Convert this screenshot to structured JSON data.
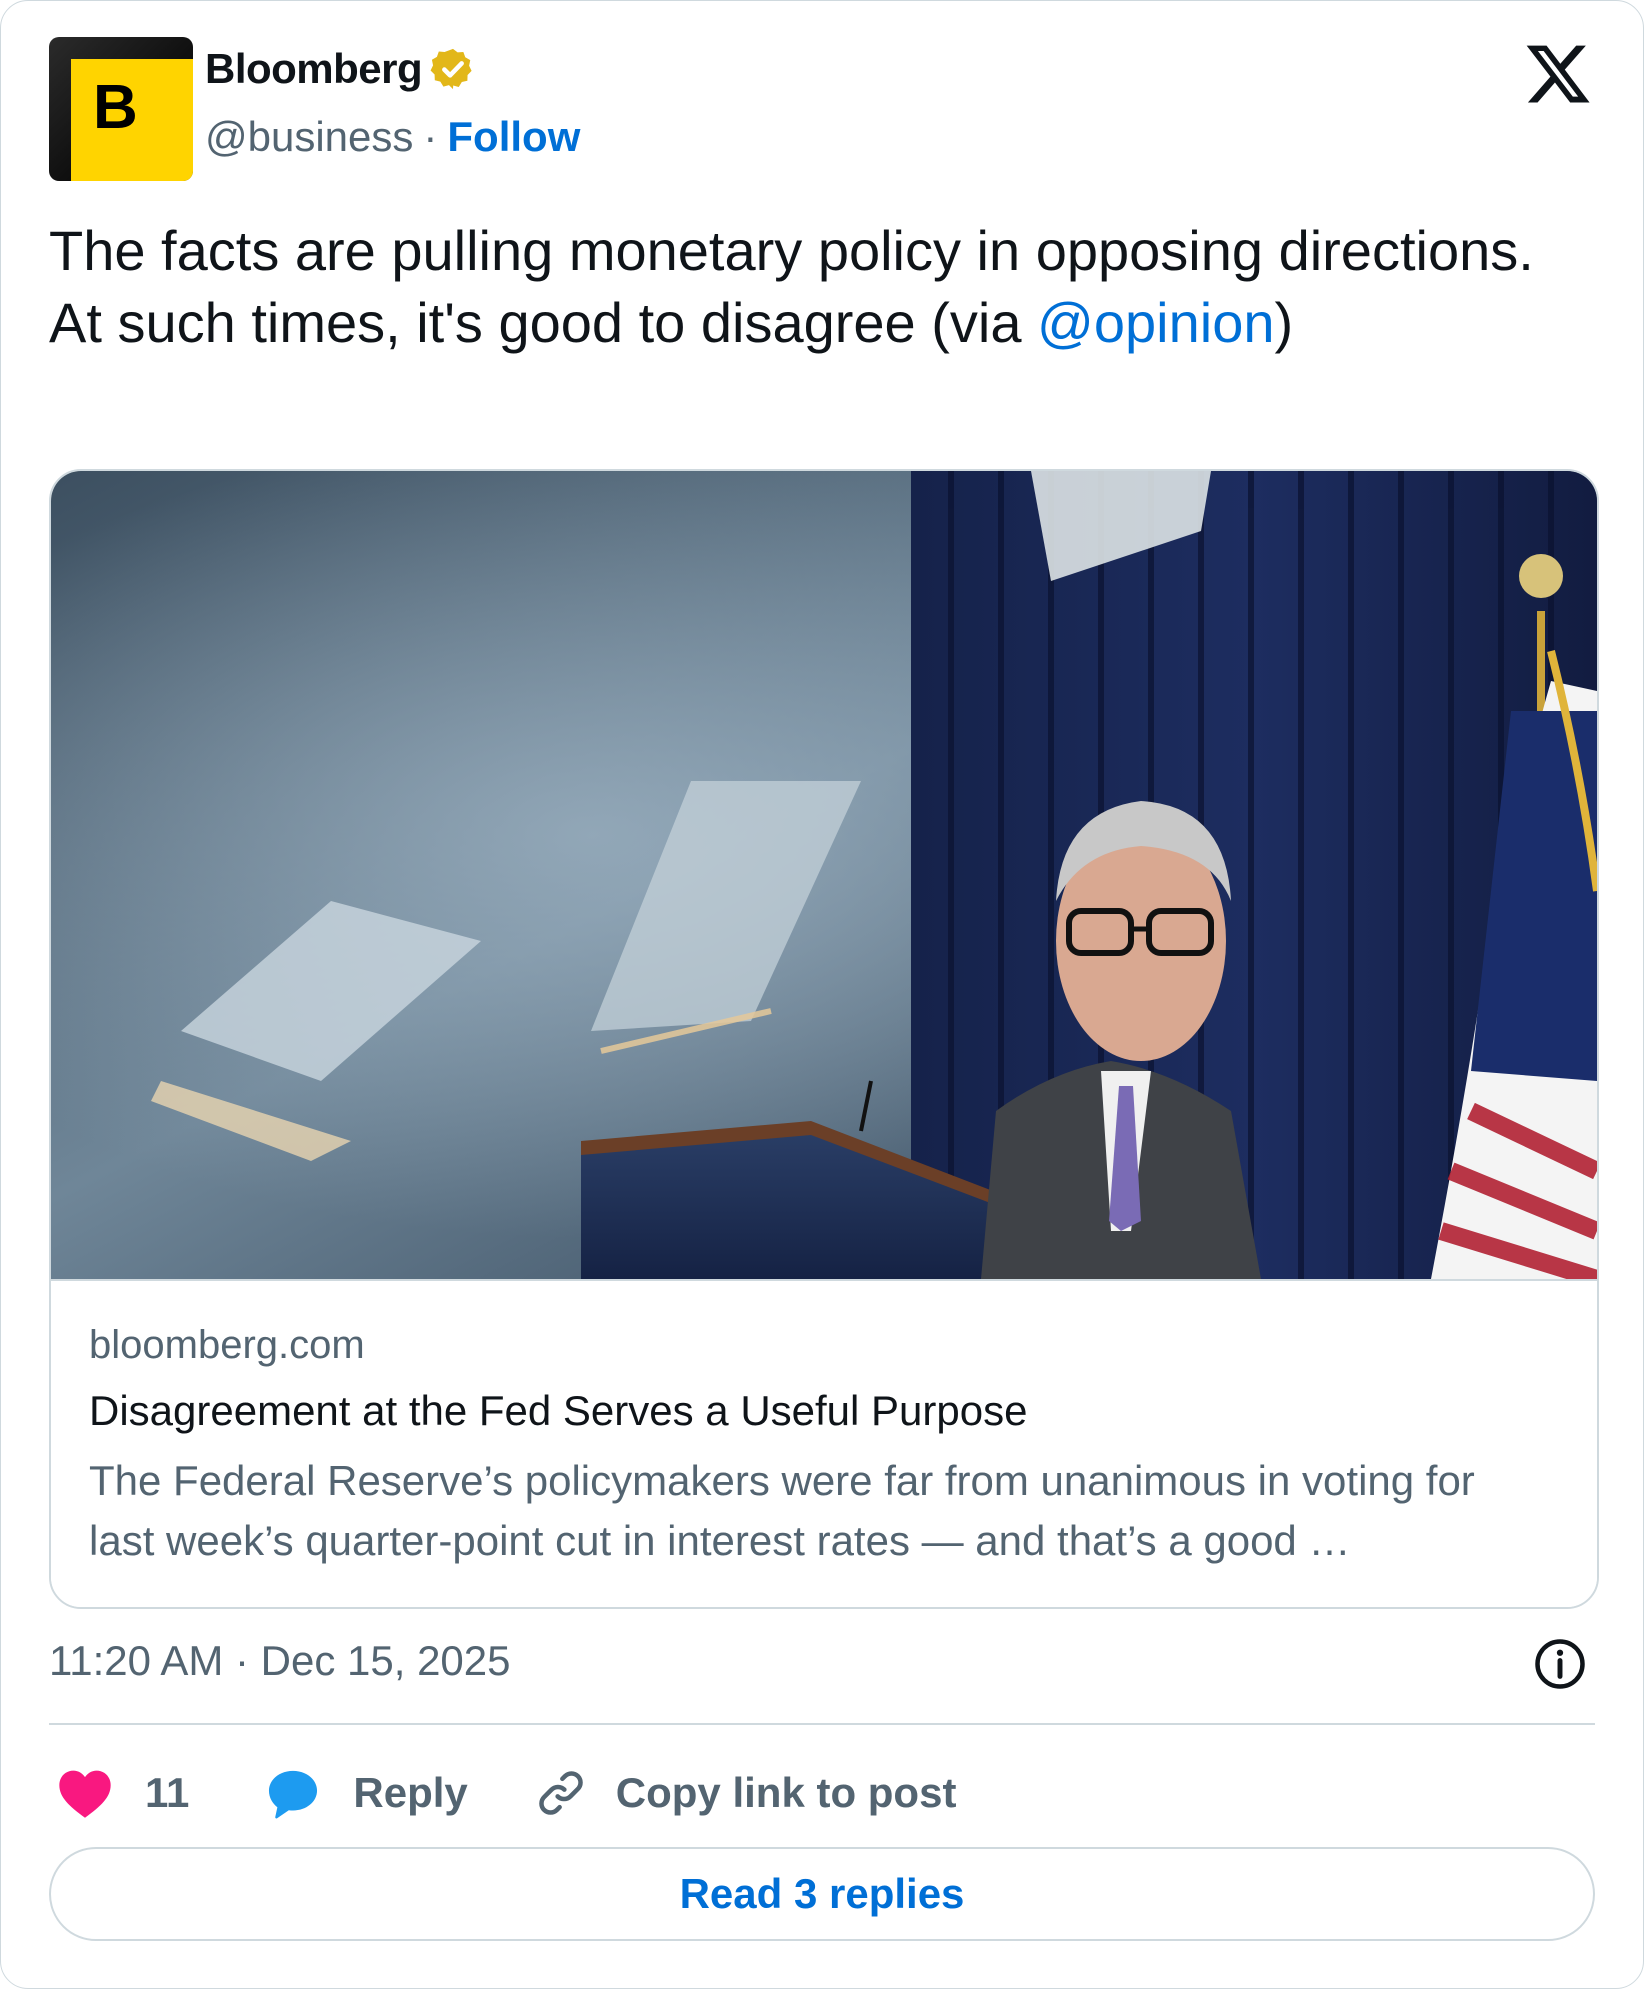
{
  "account": {
    "name": "Bloomberg",
    "handle": "@business",
    "separator": "·",
    "follow_label": "Follow",
    "avatar_letter": "B",
    "verified": true,
    "badge_color": "#e2b719"
  },
  "tweet": {
    "text": "The facts are pulling monetary policy in opposing directions. At such times, it's good to disagree (via ",
    "mention": "@opinion",
    "text_end": ")"
  },
  "link_card": {
    "domain": "bloomberg.com",
    "title": "Disagreement at the Fed Serves a Useful Purpose",
    "description": "The Federal Reserve’s policymakers were far from unanimous in voting for last week’s quarter-point cut in interest rates — and that’s a good …"
  },
  "meta": {
    "timestamp": "11:20 AM · Dec 15, 2025"
  },
  "actions": {
    "like_count": "11",
    "reply_label": "Reply",
    "copy_link_label": "Copy link to post"
  },
  "read_replies_label": "Read 3 replies",
  "colors": {
    "link_blue": "#006fd6",
    "heart_pink": "#f91880",
    "reply_blue": "#1d9bf0",
    "border": "#cfd9de",
    "muted_text": "#536471"
  },
  "icons": [
    "verified-badge-icon",
    "x-logo-icon",
    "info-icon",
    "heart-icon",
    "reply-bubble-icon",
    "link-icon"
  ]
}
